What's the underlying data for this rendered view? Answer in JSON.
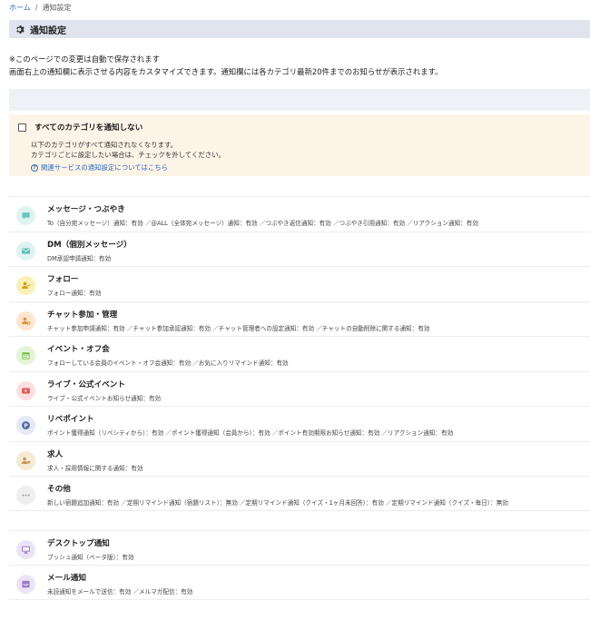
{
  "breadcrumb": {
    "home": "ホーム",
    "separator": "/",
    "current": "通知設定"
  },
  "header": {
    "title": "通知設定"
  },
  "notes": {
    "line1": "※このページでの変更は自動で保存されます",
    "line2": "画面右上の通知欄に表示させる内容をカスタマイズできます。通知欄には各カテゴリ最新20件までのお知らせが表示されます。"
  },
  "mute_all": {
    "label": "すべてのカテゴリを通知しない",
    "desc1": "以下のカテゴリがすべて通知されなくなります。",
    "desc2": "カテゴリごとに設定したい場合は、チェックを外してください。",
    "help_link": "関連サービスの通知設定についてはこちら",
    "checked": false
  },
  "categories": [
    {
      "name": "メッセージ・つぶやき",
      "detail": "To（自分宛メッセージ）通知：有効 ／@ALL（全体宛メッセージ）通知：有効 ／つぶやき返信通知：有効 ／つぶやき引用通知：有効 ／リアクション通知：有効",
      "icon": "message-bubble-icon",
      "icon_bg": "#dff3f1",
      "icon_color": "#6bc7bd"
    },
    {
      "name": "DM（個別メッセージ）",
      "detail": "DM承認申請通知：有効",
      "icon": "mail-icon",
      "icon_bg": "#dff3f3",
      "icon_color": "#63c0c0"
    },
    {
      "name": "フォロー",
      "detail": "フォロー通知：有効",
      "icon": "user-follow-icon",
      "icon_bg": "#fbefb8",
      "icon_color": "#c9a11b"
    },
    {
      "name": "チャット参加・管理",
      "detail": "チャット参加申請通知：有効 ／チャット参加承認通知：有効 ／チャット管理者への設定通知：有効 ／チャットの自動削除に関する通知：有効",
      "icon": "user-settings-icon",
      "icon_bg": "#fde6cf",
      "icon_color": "#e09040"
    },
    {
      "name": "イベント・オフ会",
      "detail": "フォローしている会員のイベント・オフ会通知：有効 ／お気に入りリマインド通知：有効",
      "icon": "calendar-icon",
      "icon_bg": "#e4f4d8",
      "icon_color": "#7cbf4f"
    },
    {
      "name": "ライブ・公式イベント",
      "detail": "ライブ・公式イベントお知らせ通知：有効",
      "icon": "play-video-icon",
      "icon_bg": "#fbe0e0",
      "icon_color": "#e06060"
    },
    {
      "name": "リベポイント",
      "detail": "ポイント獲得通知（リベシティから）：有効 ／ポイント獲得通知（会員から）：有効 ／ポイント有効期限お知らせ通知：有効 ／リアクション通知：有効",
      "icon": "point-coin-icon",
      "icon_bg": "#e3e9f6",
      "icon_color": "#5a6fa6"
    },
    {
      "name": "求人",
      "detail": "求人・採用情報に関する通知：有効",
      "icon": "job-user-icon",
      "icon_bg": "#f6ead7",
      "icon_color": "#c49a55"
    },
    {
      "name": "その他",
      "detail": "新しい宿題追加通知：有効 ／定期リマインド通知（宿題リスト）：無効 ／定期リマインド通知（クイズ・1ヶ月未回答）：有効 ／定期リマインド通知（クイズ・毎日）：無効",
      "icon": "more-dots-icon",
      "icon_bg": "#efefef",
      "icon_color": "#999999"
    },
    {
      "name": "デスクトップ通知",
      "detail": "プッシュ通知（ベータ版）：有効",
      "icon": "desktop-monitor-icon",
      "icon_bg": "#ece4f6",
      "icon_color": "#9a7cc8"
    },
    {
      "name": "メール通知",
      "detail": "未読通知をメールで送信：有効 ／メルマガ配信：有効",
      "icon": "inbox-tray-icon",
      "icon_bg": "#ece4f6",
      "icon_color": "#9a7cc8"
    }
  ]
}
